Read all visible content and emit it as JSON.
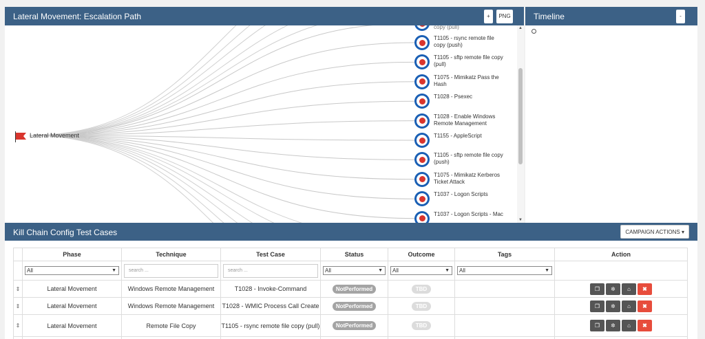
{
  "escalation": {
    "title": "Lateral Movement: Escalation Path",
    "plus_label": "+",
    "png_label": "PNG",
    "root_label": "Lateral Movement",
    "techniques": [
      {
        "label": "T1105 - rsync remote file copy (push)"
      },
      {
        "label": "T1105 - sftp remote file copy (pull)"
      },
      {
        "label": "T1075 - Mimikatz Pass the Hash"
      },
      {
        "label": "T1028 - Psexec"
      },
      {
        "label": "T1028 - Enable Windows Remote Management"
      },
      {
        "label": "T1155 - AppleScript"
      },
      {
        "label": "T1105 - sftp remote file copy (push)"
      },
      {
        "label": "T1075 - Mimikatz Kerberos Ticket Attack"
      },
      {
        "label": "T1037 - Logon Scripts"
      },
      {
        "label": "T1037 - Logon Scripts - Mac"
      }
    ],
    "partial_top_label": "copy (pull)"
  },
  "timeline": {
    "title": "Timeline",
    "minus_label": "-"
  },
  "killchain": {
    "title": "Kill Chain Config Test Cases",
    "campaign_label": "CAMPAIGN ACTIONS",
    "columns": [
      "Phase",
      "Technique",
      "Test Case",
      "Status",
      "Outcome",
      "Tags",
      "Action"
    ],
    "filters": {
      "phase": "All",
      "technique_placeholder": "search ...",
      "testcase_placeholder": "search ...",
      "status": "All",
      "outcome": "All",
      "tags": "All"
    },
    "rows": [
      {
        "phase": "Lateral Movement",
        "technique": "Windows Remote Management",
        "test_case": "T1028 - Invoke-Command",
        "status": "NotPerformed",
        "outcome": "TBD"
      },
      {
        "phase": "Lateral Movement",
        "technique": "Windows Remote Management",
        "test_case": "T1028 - WMIC Process Call Create",
        "status": "NotPerformed",
        "outcome": "TBD"
      },
      {
        "phase": "Lateral Movement",
        "technique": "Remote File Copy",
        "test_case": "T1105 - rsync remote file copy (pull)",
        "status": "NotPerformed",
        "outcome": "TBD"
      }
    ],
    "action_icons": [
      "copy-icon",
      "gear-icon",
      "tags-icon",
      "delete-icon"
    ]
  },
  "colors": {
    "header_bg": "#3c6186",
    "target_blue": "#1a5fb4",
    "target_red": "#d9352d",
    "delete_red": "#e74c3c"
  }
}
